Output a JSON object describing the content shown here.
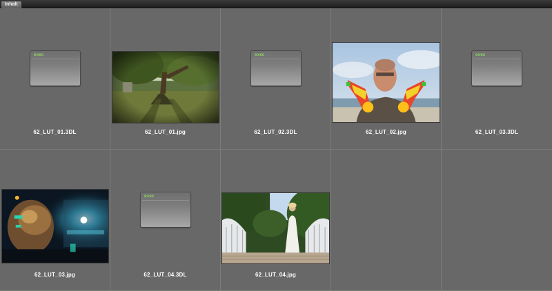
{
  "tab": {
    "label": "Inhalt"
  },
  "file_icon": {
    "label": "exec"
  },
  "items": [
    {
      "name": "62_LUT_01.3DL",
      "kind": "exec"
    },
    {
      "name": "62_LUT_01.jpg",
      "kind": "image",
      "subject": "tree-park"
    },
    {
      "name": "62_LUT_02.3DL",
      "kind": "exec"
    },
    {
      "name": "62_LUT_02.jpg",
      "kind": "image",
      "subject": "man-water-guns"
    },
    {
      "name": "62_LUT_03.3DL",
      "kind": "exec"
    },
    {
      "name": "62_LUT_03.jpg",
      "kind": "image",
      "subject": "robot-scifi"
    },
    {
      "name": "62_LUT_04.3DL",
      "kind": "exec"
    },
    {
      "name": "62_LUT_04.jpg",
      "kind": "image",
      "subject": "bride-bridge"
    }
  ]
}
